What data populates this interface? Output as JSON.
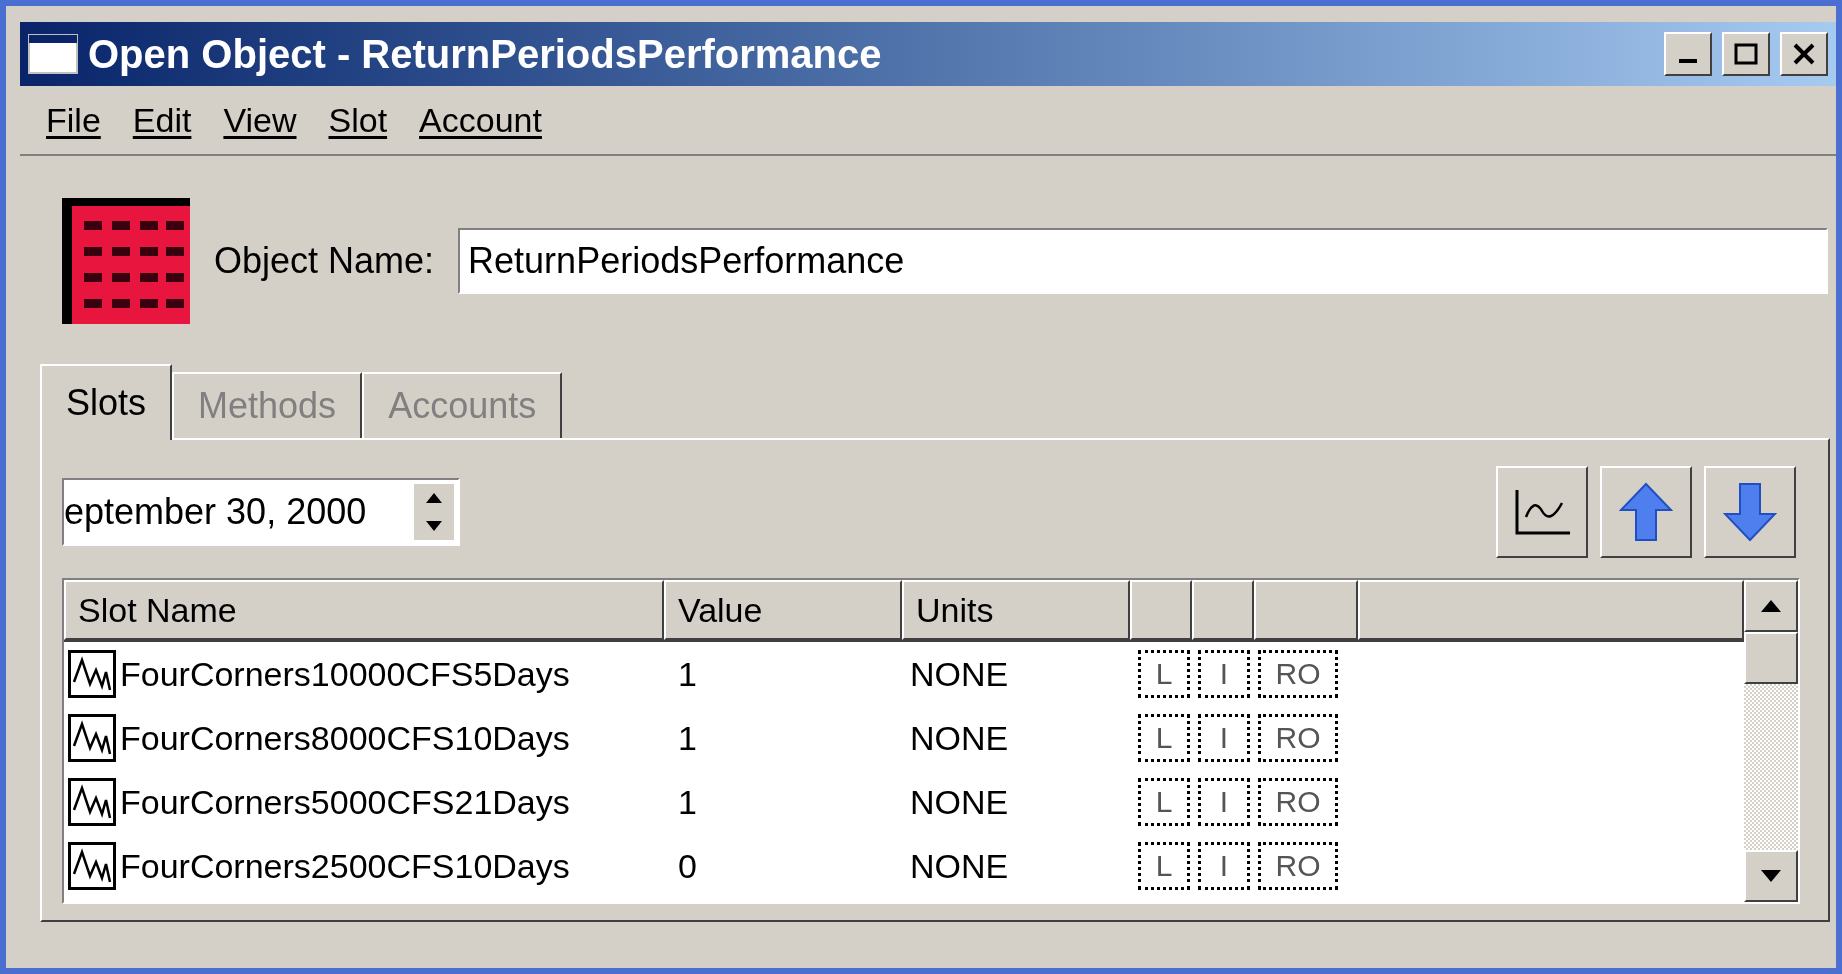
{
  "window": {
    "title": "Open Object - ReturnPeriodsPerformance"
  },
  "menu": [
    "File",
    "Edit",
    "View",
    "Slot",
    "Account"
  ],
  "object_name": {
    "label": "Object Name:",
    "value": "ReturnPeriodsPerformance"
  },
  "tabs": [
    {
      "label": "Slots",
      "selected": true
    },
    {
      "label": "Methods",
      "selected": false
    },
    {
      "label": "Accounts",
      "selected": false
    }
  ],
  "date_field": {
    "value": "eptember 30, 2000"
  },
  "table": {
    "columns": [
      "Slot Name",
      "Value",
      "Units"
    ],
    "rows": [
      {
        "slot_name": "FourCorners10000CFS5Days",
        "value": "1",
        "units": "NONE",
        "flags": [
          {
            "label": "L",
            "on": false
          },
          {
            "label": "I",
            "on": false
          },
          {
            "label": "RO",
            "on": false
          }
        ]
      },
      {
        "slot_name": "FourCorners8000CFS10Days",
        "value": "1",
        "units": "NONE",
        "flags": [
          {
            "label": "L",
            "on": false
          },
          {
            "label": "I",
            "on": false
          },
          {
            "label": "RO",
            "on": false
          }
        ]
      },
      {
        "slot_name": "FourCorners5000CFS21Days",
        "value": "1",
        "units": "NONE",
        "flags": [
          {
            "label": "L",
            "on": false
          },
          {
            "label": "I",
            "on": false
          },
          {
            "label": "RO",
            "on": false
          }
        ]
      },
      {
        "slot_name": "FourCorners2500CFS10Days",
        "value": "0",
        "units": "NONE",
        "flags": [
          {
            "label": "L",
            "on": false
          },
          {
            "label": "I",
            "on": false
          },
          {
            "label": "RO",
            "on": false
          }
        ]
      }
    ]
  }
}
